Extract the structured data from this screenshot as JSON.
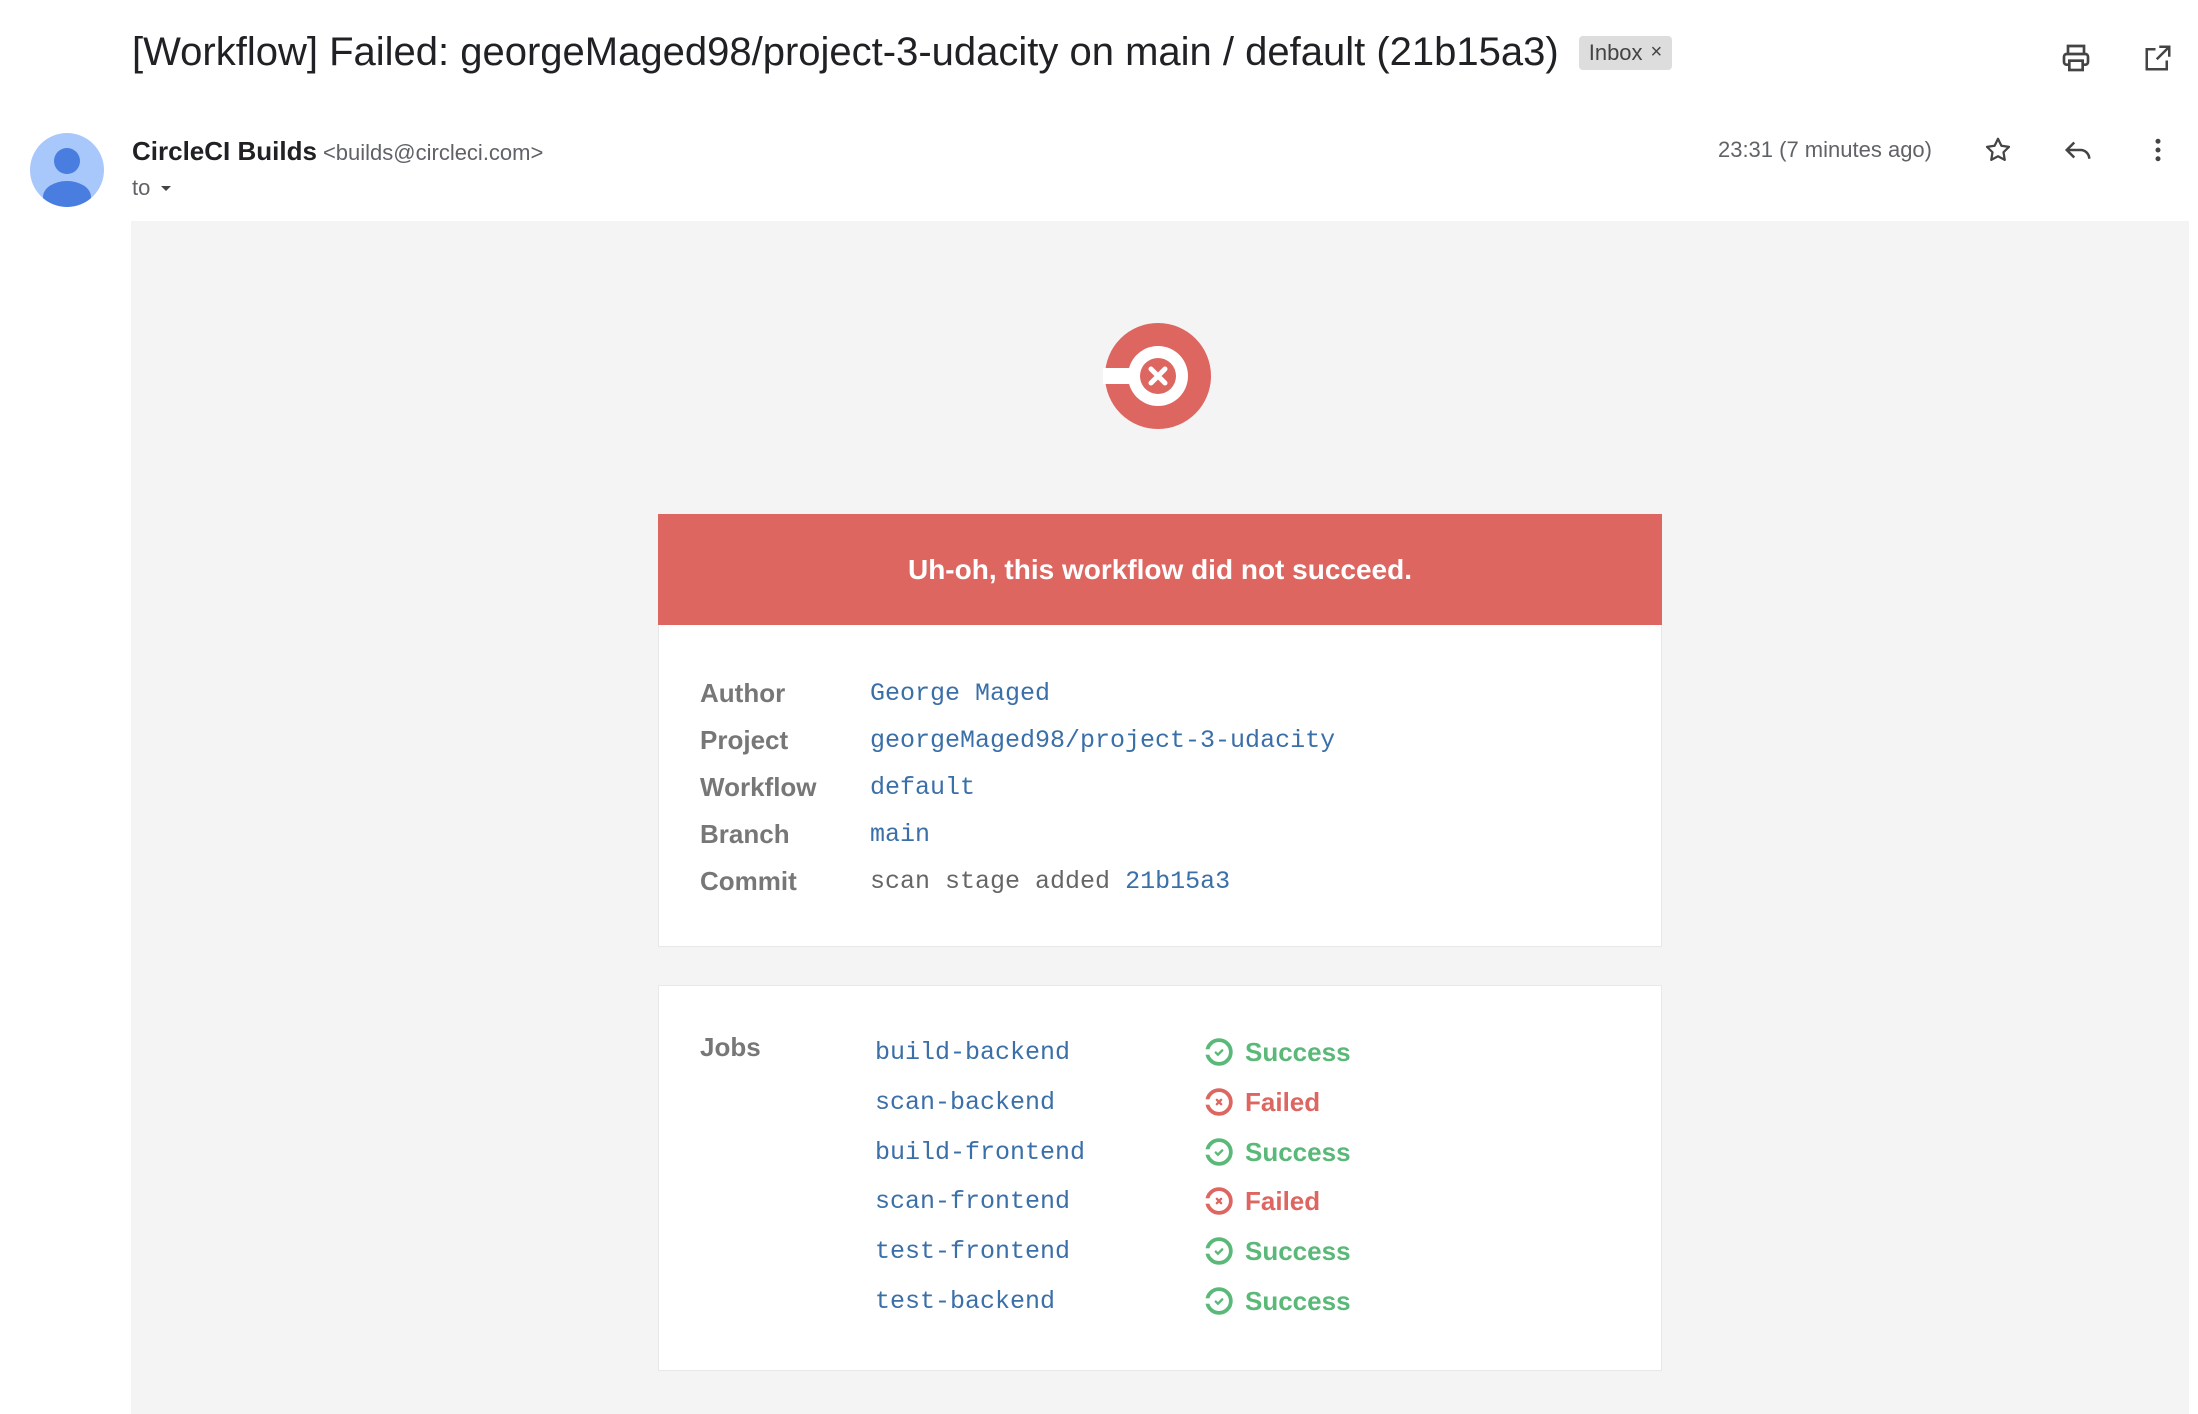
{
  "email": {
    "subject": "[Workflow] Failed: georgeMaged98/project-3-udacity on main / default (21b15a3)",
    "label_chip": "Inbox",
    "label_close": "×",
    "sender_name": "CircleCI Builds",
    "sender_email": "<builds@circleci.com>",
    "to_label": "to",
    "timestamp": "23:31 (7 minutes ago)"
  },
  "icons": {
    "print": "print-icon",
    "open_new": "open-in-new-window-icon",
    "star": "star-icon",
    "reply": "reply-icon",
    "more": "more-vertical-icon",
    "circleci_failed": "circleci-failed-logo"
  },
  "notification": {
    "banner": "Uh-oh, this workflow did not succeed.",
    "details": [
      {
        "label": "Author",
        "value": "George Maged"
      },
      {
        "label": "Project",
        "value": "georgeMaged98/project-3-udacity"
      },
      {
        "label": "Workflow",
        "value": "default"
      },
      {
        "label": "Branch",
        "value": "main"
      },
      {
        "label": "Commit",
        "message": "scan stage added",
        "hash": "21b15a3"
      }
    ],
    "jobs_label": "Jobs",
    "jobs": [
      {
        "name": "build-backend",
        "status": "Success"
      },
      {
        "name": "scan-backend",
        "status": "Failed"
      },
      {
        "name": "build-frontend",
        "status": "Success"
      },
      {
        "name": "scan-frontend",
        "status": "Failed"
      },
      {
        "name": "test-frontend",
        "status": "Success"
      },
      {
        "name": "test-backend",
        "status": "Success"
      }
    ]
  },
  "colors": {
    "failure_red": "#dd6661",
    "success_green": "#5ab978",
    "link_blue": "#3b6fa8",
    "body_background": "#f4f4f4"
  }
}
